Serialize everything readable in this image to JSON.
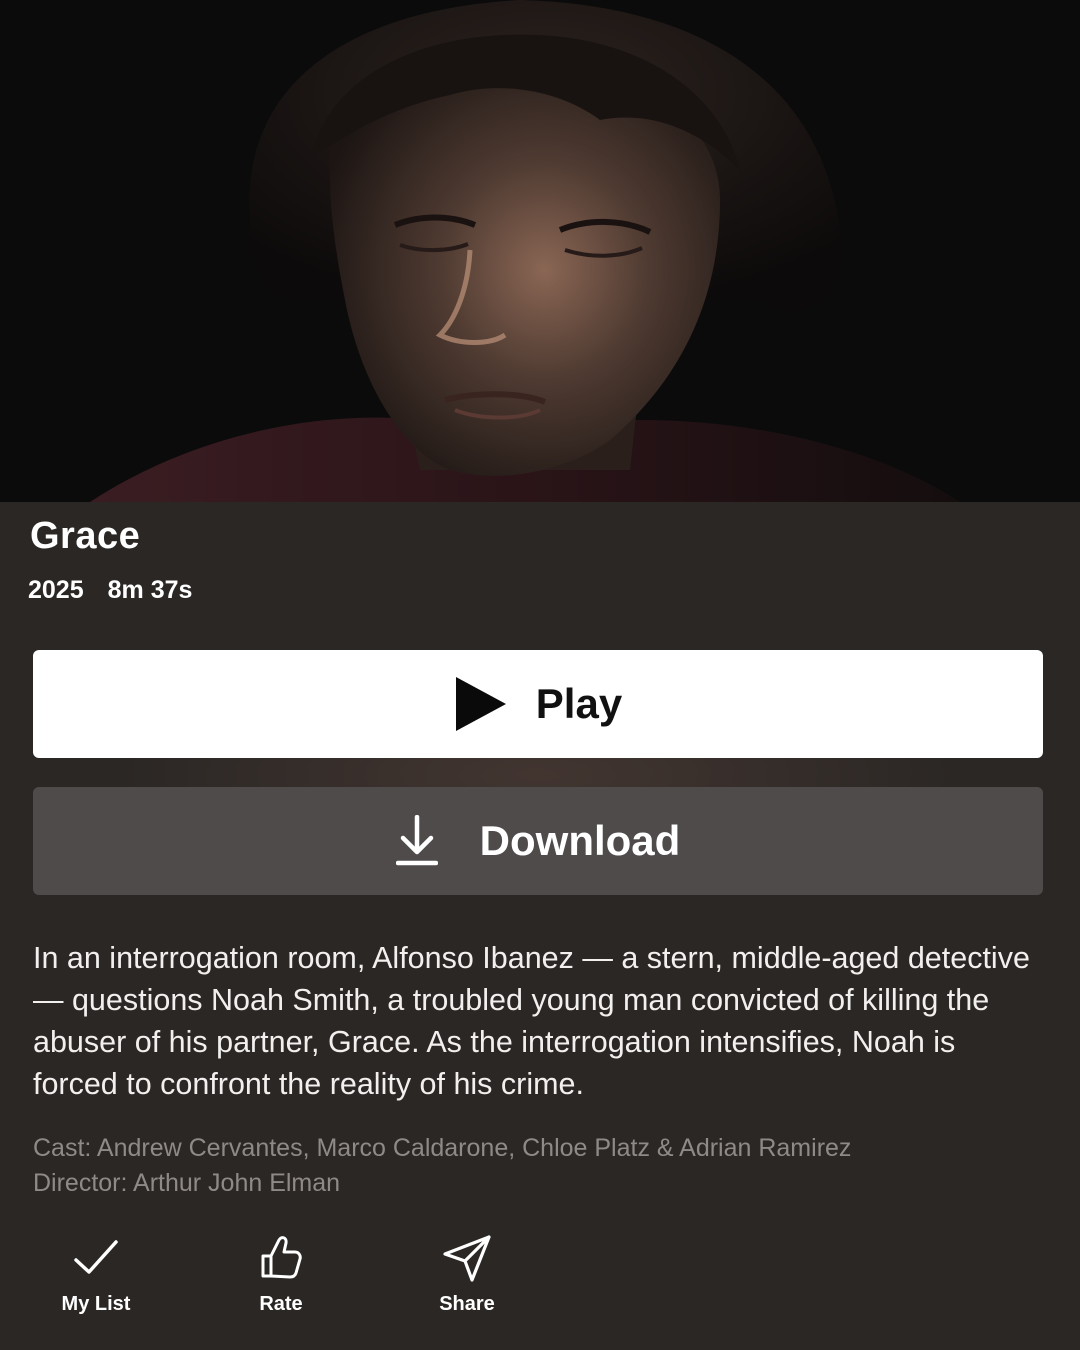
{
  "title": "Grace",
  "meta": {
    "year": "2025",
    "duration": "8m 37s"
  },
  "buttons": {
    "play": "Play",
    "download": "Download"
  },
  "description": "In an interrogation room, Alfonso Ibanez — a stern, middle-aged detective — questions Noah Smith, a troubled young man convicted of killing the abuser of his partner, Grace. As the interrogation intensifies, Noah is forced to confront the reality of his crime.",
  "cast": "Cast: Andrew Cervantes, Marco Caldarone, Chloe Platz & Adrian Ramirez",
  "director": "Director: Arthur John Elman",
  "actions": {
    "my_list": "My List",
    "rate": "Rate",
    "share": "Share"
  },
  "icons": {
    "play": "play-icon",
    "download": "download-icon",
    "my_list": "check-icon",
    "rate": "thumbs-up-icon",
    "share": "send-icon"
  },
  "colors": {
    "background": "#2b2725",
    "play_button": "#ffffff",
    "download_button": "#4e4b4a",
    "credits_text": "#8f8a88"
  }
}
